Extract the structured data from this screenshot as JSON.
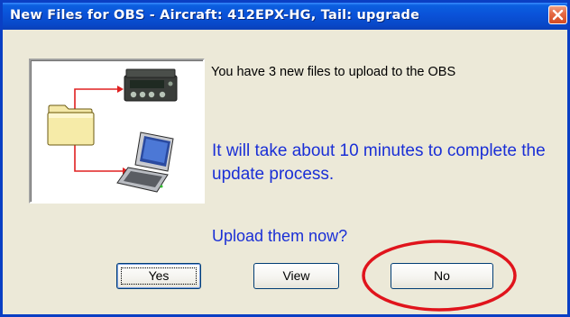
{
  "window": {
    "title": "New Files for OBS - Aircraft: 412EPX-HG, Tail: upgrade"
  },
  "message": {
    "line1": "You have 3 new files to upload to the OBS",
    "line2": "It will take about 10 minutes to complete the update process.",
    "line3": "Upload them now?"
  },
  "buttons": {
    "yes": "Yes",
    "view": "View",
    "no": "No"
  },
  "colors": {
    "titlebar": "#0a52d8",
    "message_blue": "#1a2fd6",
    "annotation_red": "#e0141c",
    "arrow_red": "#e02020"
  },
  "icons": {
    "illustration": [
      "folder-icon",
      "obs-device-icon",
      "laptop-icon",
      "arrow-icon"
    ],
    "close": "close-icon"
  }
}
